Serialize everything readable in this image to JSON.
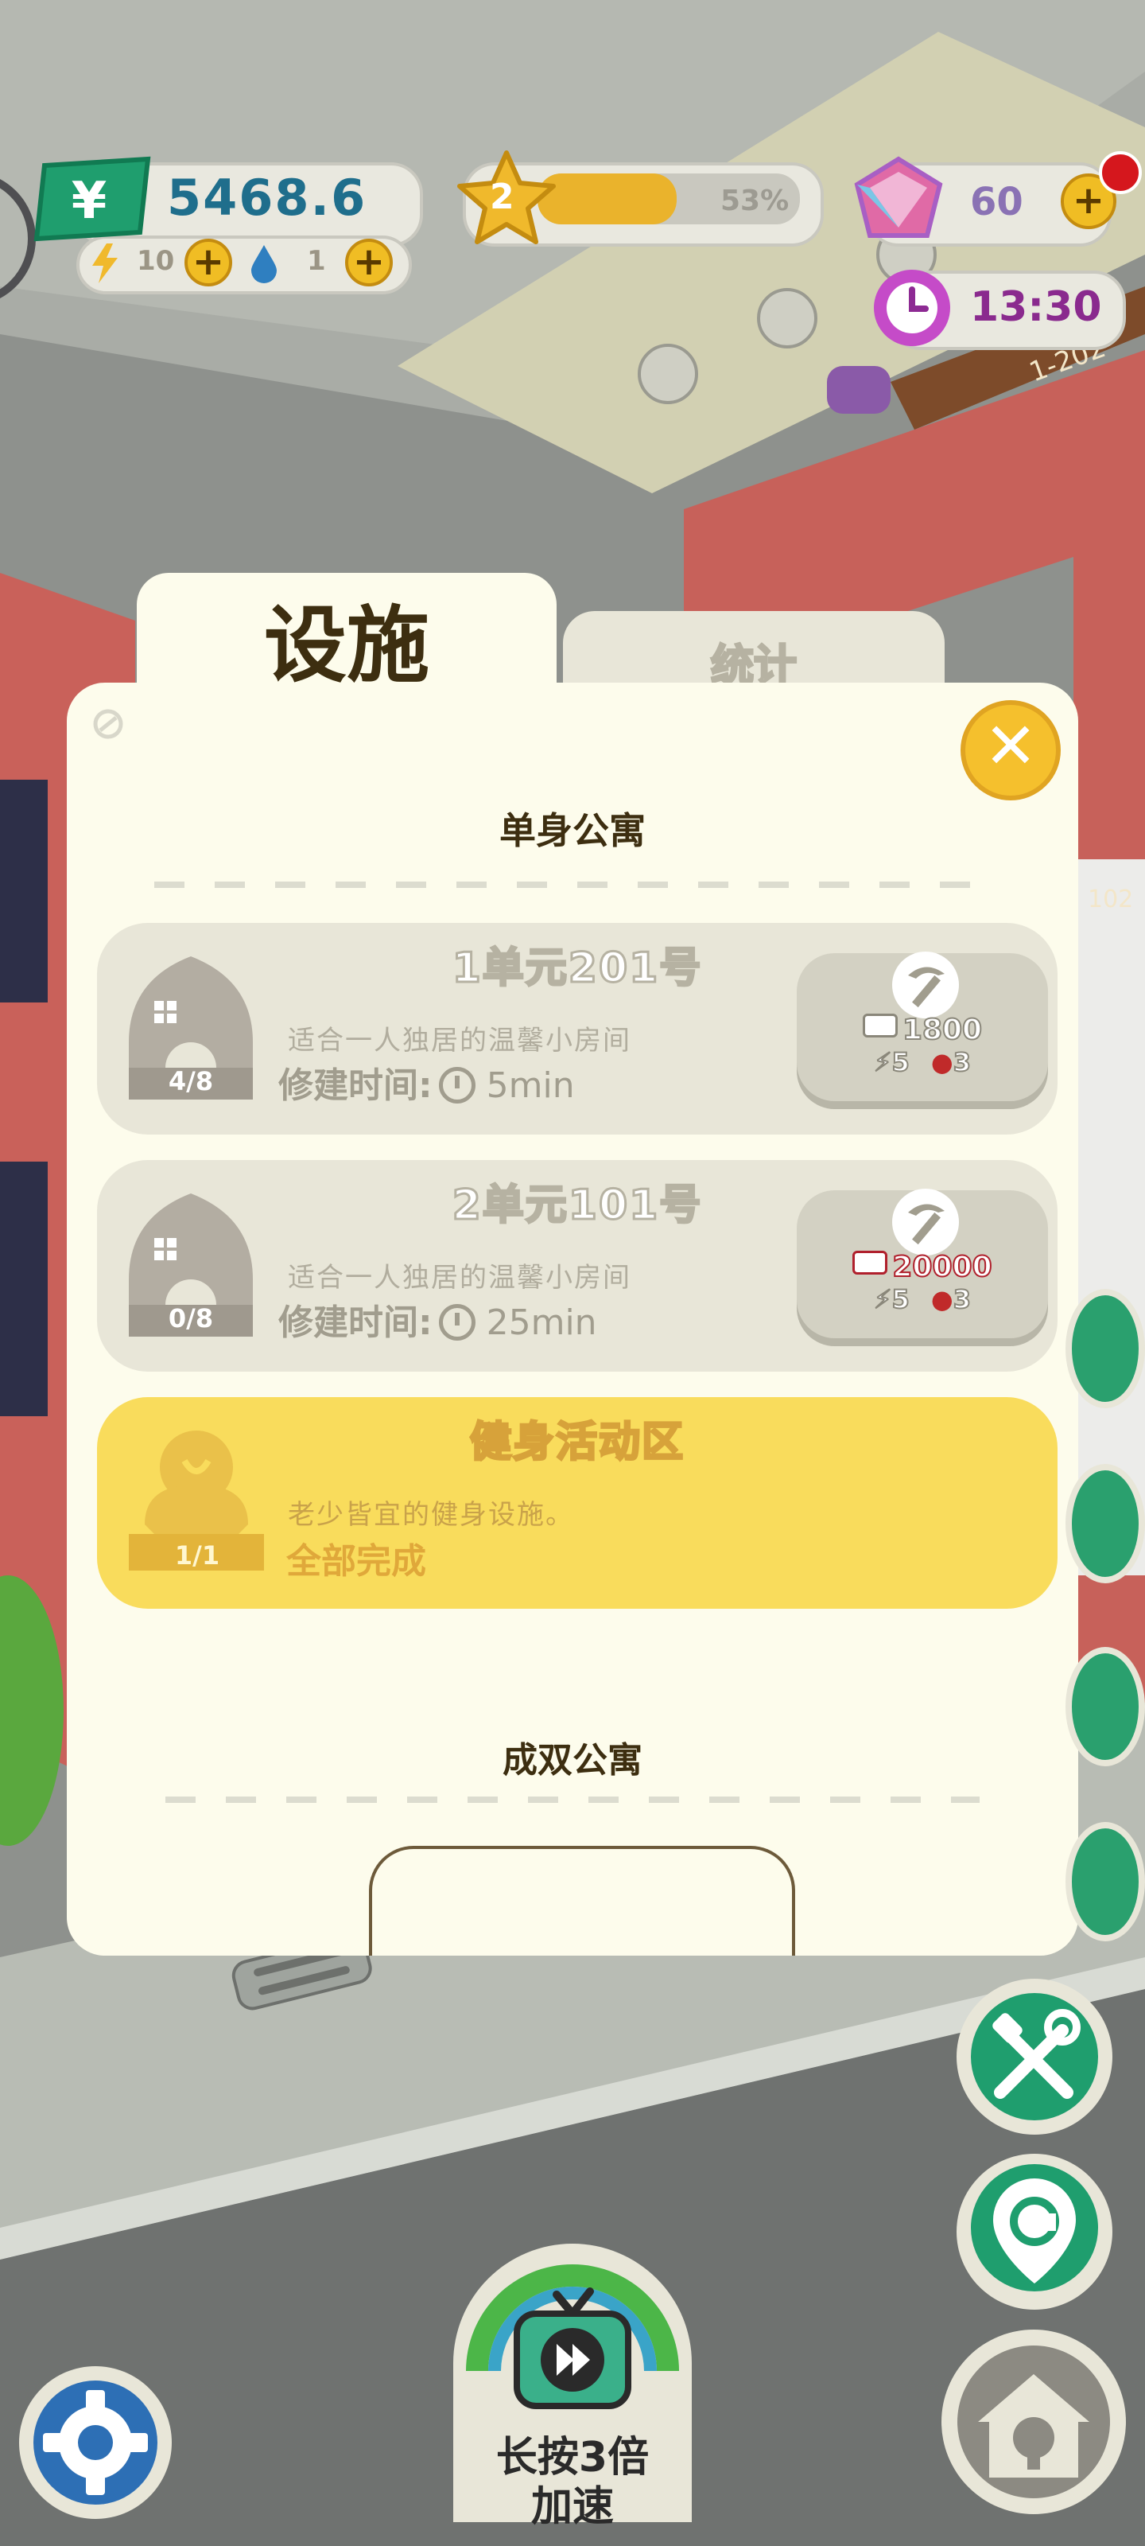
{
  "hud": {
    "money": "5468.6",
    "energy": "10",
    "water": "1",
    "level": "2",
    "level_progress_text": "53%",
    "level_progress": 0.53,
    "gems": "60",
    "clock": "13:30",
    "room_sign": "1-202",
    "room_sign_2": "102"
  },
  "panel": {
    "tab_active": "设施",
    "tab_inactive": "统计",
    "section1": "单身公寓",
    "section2": "成双公寓",
    "cards": [
      {
        "title": "1单元201号",
        "desc": "适合一人独居的温馨小房间",
        "time_label": "修建时间:",
        "time_value": "5min",
        "count": "4/8",
        "cost": "1800",
        "energy_req": "5",
        "water_req": "3"
      },
      {
        "title": "2单元101号",
        "desc": "适合一人独居的温馨小房间",
        "time_label": "修建时间:",
        "time_value": "25min",
        "count": "0/8",
        "cost": "20000",
        "energy_req": "5",
        "water_req": "3"
      },
      {
        "title": "健身活动区",
        "desc": "老少皆宜的健身设施。",
        "status": "全部完成",
        "count": "1/1"
      }
    ]
  },
  "bottom": {
    "speed_line1": "长按3倍",
    "speed_line2": "加速"
  },
  "colors": {
    "panel_bg": "#fdfcec",
    "card_bg": "#e8e6d8",
    "done_bg": "#f9dc5c",
    "accent_yellow": "#f5c02d",
    "green_button": "#1f9e6e"
  }
}
